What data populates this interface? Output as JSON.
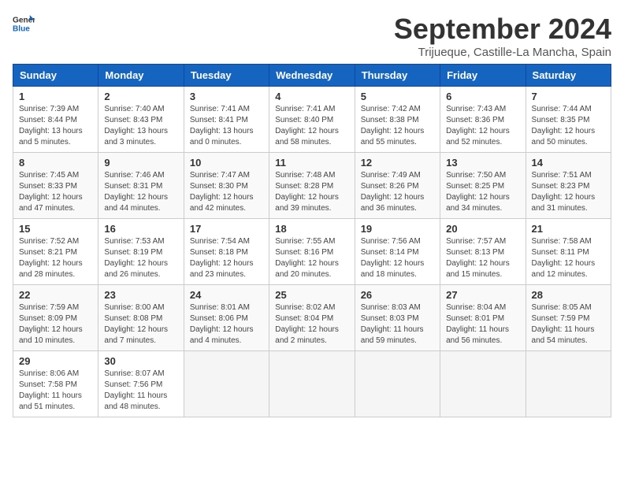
{
  "header": {
    "logo_line1": "General",
    "logo_line2": "Blue",
    "month_title": "September 2024",
    "location": "Trijueque, Castille-La Mancha, Spain"
  },
  "days_of_week": [
    "Sunday",
    "Monday",
    "Tuesday",
    "Wednesday",
    "Thursday",
    "Friday",
    "Saturday"
  ],
  "weeks": [
    [
      {
        "day": 1,
        "sunrise": "7:39 AM",
        "sunset": "8:44 PM",
        "daylight": "13 hours and 5 minutes."
      },
      {
        "day": 2,
        "sunrise": "7:40 AM",
        "sunset": "8:43 PM",
        "daylight": "13 hours and 3 minutes."
      },
      {
        "day": 3,
        "sunrise": "7:41 AM",
        "sunset": "8:41 PM",
        "daylight": "13 hours and 0 minutes."
      },
      {
        "day": 4,
        "sunrise": "7:41 AM",
        "sunset": "8:40 PM",
        "daylight": "12 hours and 58 minutes."
      },
      {
        "day": 5,
        "sunrise": "7:42 AM",
        "sunset": "8:38 PM",
        "daylight": "12 hours and 55 minutes."
      },
      {
        "day": 6,
        "sunrise": "7:43 AM",
        "sunset": "8:36 PM",
        "daylight": "12 hours and 52 minutes."
      },
      {
        "day": 7,
        "sunrise": "7:44 AM",
        "sunset": "8:35 PM",
        "daylight": "12 hours and 50 minutes."
      }
    ],
    [
      {
        "day": 8,
        "sunrise": "7:45 AM",
        "sunset": "8:33 PM",
        "daylight": "12 hours and 47 minutes."
      },
      {
        "day": 9,
        "sunrise": "7:46 AM",
        "sunset": "8:31 PM",
        "daylight": "12 hours and 44 minutes."
      },
      {
        "day": 10,
        "sunrise": "7:47 AM",
        "sunset": "8:30 PM",
        "daylight": "12 hours and 42 minutes."
      },
      {
        "day": 11,
        "sunrise": "7:48 AM",
        "sunset": "8:28 PM",
        "daylight": "12 hours and 39 minutes."
      },
      {
        "day": 12,
        "sunrise": "7:49 AM",
        "sunset": "8:26 PM",
        "daylight": "12 hours and 36 minutes."
      },
      {
        "day": 13,
        "sunrise": "7:50 AM",
        "sunset": "8:25 PM",
        "daylight": "12 hours and 34 minutes."
      },
      {
        "day": 14,
        "sunrise": "7:51 AM",
        "sunset": "8:23 PM",
        "daylight": "12 hours and 31 minutes."
      }
    ],
    [
      {
        "day": 15,
        "sunrise": "7:52 AM",
        "sunset": "8:21 PM",
        "daylight": "12 hours and 28 minutes."
      },
      {
        "day": 16,
        "sunrise": "7:53 AM",
        "sunset": "8:19 PM",
        "daylight": "12 hours and 26 minutes."
      },
      {
        "day": 17,
        "sunrise": "7:54 AM",
        "sunset": "8:18 PM",
        "daylight": "12 hours and 23 minutes."
      },
      {
        "day": 18,
        "sunrise": "7:55 AM",
        "sunset": "8:16 PM",
        "daylight": "12 hours and 20 minutes."
      },
      {
        "day": 19,
        "sunrise": "7:56 AM",
        "sunset": "8:14 PM",
        "daylight": "12 hours and 18 minutes."
      },
      {
        "day": 20,
        "sunrise": "7:57 AM",
        "sunset": "8:13 PM",
        "daylight": "12 hours and 15 minutes."
      },
      {
        "day": 21,
        "sunrise": "7:58 AM",
        "sunset": "8:11 PM",
        "daylight": "12 hours and 12 minutes."
      }
    ],
    [
      {
        "day": 22,
        "sunrise": "7:59 AM",
        "sunset": "8:09 PM",
        "daylight": "12 hours and 10 minutes."
      },
      {
        "day": 23,
        "sunrise": "8:00 AM",
        "sunset": "8:08 PM",
        "daylight": "12 hours and 7 minutes."
      },
      {
        "day": 24,
        "sunrise": "8:01 AM",
        "sunset": "8:06 PM",
        "daylight": "12 hours and 4 minutes."
      },
      {
        "day": 25,
        "sunrise": "8:02 AM",
        "sunset": "8:04 PM",
        "daylight": "12 hours and 2 minutes."
      },
      {
        "day": 26,
        "sunrise": "8:03 AM",
        "sunset": "8:03 PM",
        "daylight": "11 hours and 59 minutes."
      },
      {
        "day": 27,
        "sunrise": "8:04 AM",
        "sunset": "8:01 PM",
        "daylight": "11 hours and 56 minutes."
      },
      {
        "day": 28,
        "sunrise": "8:05 AM",
        "sunset": "7:59 PM",
        "daylight": "11 hours and 54 minutes."
      }
    ],
    [
      {
        "day": 29,
        "sunrise": "8:06 AM",
        "sunset": "7:58 PM",
        "daylight": "11 hours and 51 minutes."
      },
      {
        "day": 30,
        "sunrise": "8:07 AM",
        "sunset": "7:56 PM",
        "daylight": "11 hours and 48 minutes."
      },
      null,
      null,
      null,
      null,
      null
    ]
  ]
}
